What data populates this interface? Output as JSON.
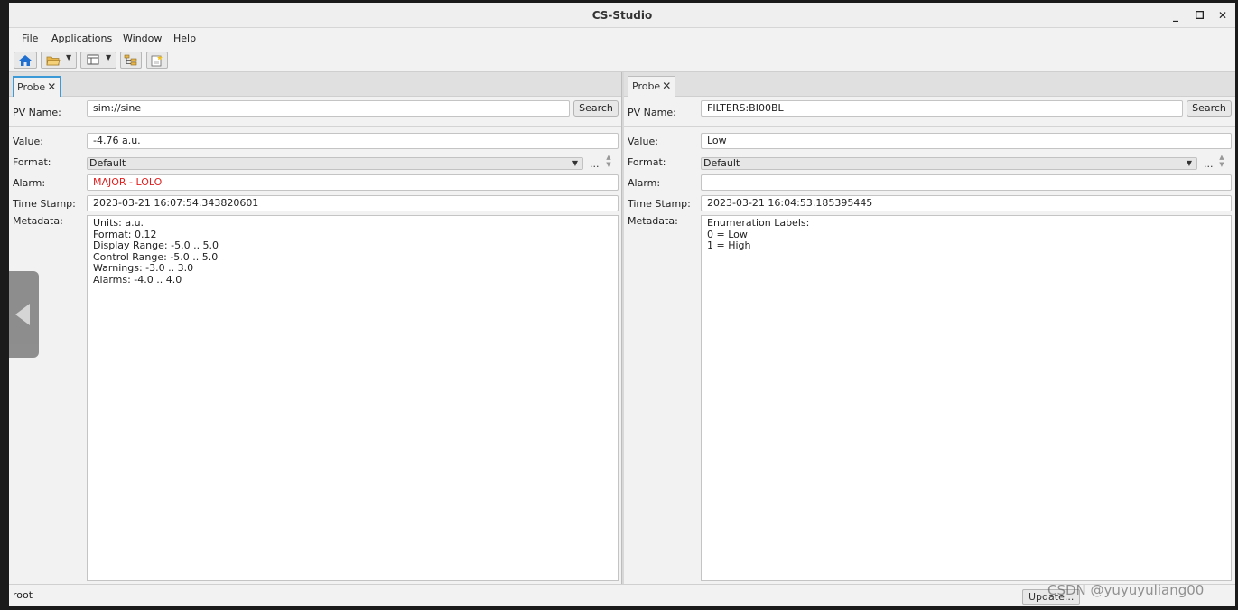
{
  "window": {
    "title": "CS-Studio",
    "controls": [
      "_",
      "▫",
      "✕"
    ]
  },
  "menubar": [
    "File",
    "Applications",
    "Window",
    "Help"
  ],
  "toolbar": {
    "icons": [
      "home-icon",
      "open-folder-icon",
      "layout-icon",
      "tree-icon",
      "new-note-icon"
    ]
  },
  "left_probe": {
    "tab_label": "Probe",
    "pv_label": "PV Name:",
    "pv_value": "sim://sine",
    "search_label": "Search",
    "value_label": "Value:",
    "value": "-4.76 a.u.",
    "format_label": "Format:",
    "format_value": "Default",
    "dots": "...",
    "alarm_label": "Alarm:",
    "alarm_value": "MAJOR - LOLO",
    "timestamp_label": "Time Stamp:",
    "timestamp_value": "2023-03-21 16:07:54.343820601",
    "metadata_label": "Metadata:",
    "metadata_lines": [
      "Units: a.u.",
      "Format: 0.12",
      "Display Range: -5.0 .. 5.0",
      "Control Range: -5.0 .. 5.0",
      "Warnings: -3.0 .. 3.0",
      "Alarms: -4.0 .. 4.0"
    ]
  },
  "right_probe": {
    "tab_label": "Probe",
    "pv_label": "PV Name:",
    "pv_value": "FILTERS:BI00BL",
    "search_label": "Search",
    "value_label": "Value:",
    "value": "Low",
    "format_label": "Format:",
    "format_value": "Default",
    "dots": "...",
    "alarm_label": "Alarm:",
    "alarm_value": "",
    "timestamp_label": "Time Stamp:",
    "timestamp_value": "2023-03-21 16:04:53.185395445",
    "metadata_label": "Metadata:",
    "metadata_lines": [
      "Enumeration Labels:",
      "0 = Low",
      "1 = High"
    ]
  },
  "statusbar": {
    "user": "root",
    "update_label": "Update...",
    "watermark": "CSDN @yuyuyuliang00"
  },
  "colors": {
    "alarm_major": "#e02020",
    "tab_accent": "#3c9bd6",
    "home_icon": "#1f6fd1"
  }
}
